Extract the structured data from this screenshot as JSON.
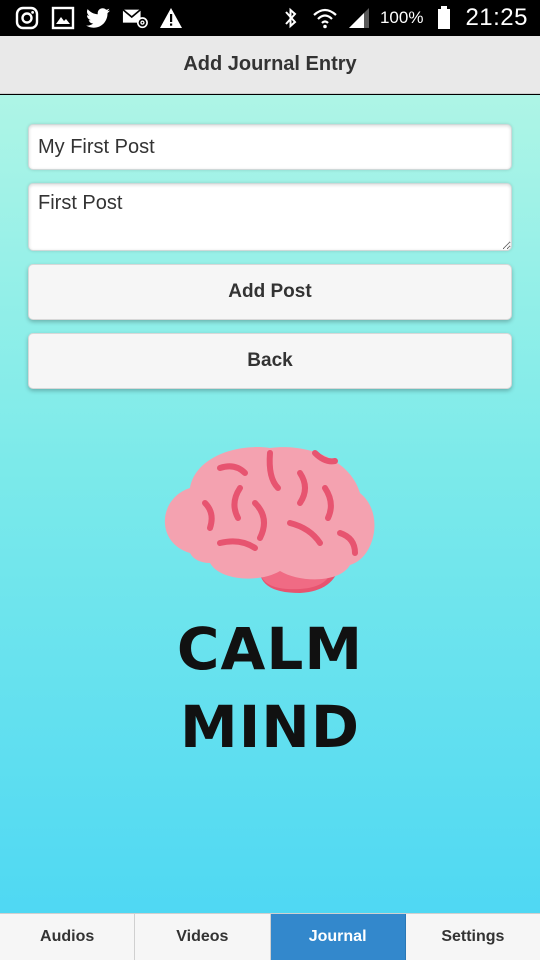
{
  "status_bar": {
    "battery": "100%",
    "time": "21:25",
    "icons": [
      "instagram-icon",
      "image-icon",
      "twitter-icon",
      "email-icon",
      "warning-icon",
      "bluetooth-icon",
      "wifi-icon",
      "signal-icon",
      "battery-icon"
    ]
  },
  "header": {
    "title": "Add Journal Entry"
  },
  "form": {
    "title_value": "My First Post",
    "body_value": "First Post",
    "add_label": "Add Post",
    "back_label": "Back"
  },
  "brand": {
    "line1": "CALM",
    "line2": "MIND",
    "logo_icon": "brain-icon"
  },
  "tabs": [
    {
      "label": "Audios",
      "active": false
    },
    {
      "label": "Videos",
      "active": false
    },
    {
      "label": "Journal",
      "active": true
    },
    {
      "label": "Settings",
      "active": false
    }
  ],
  "colors": {
    "gradient_top": "#aef5e6",
    "gradient_bottom": "#4fd8f3",
    "active_tab": "#3388cc",
    "brain": "#f4a2b0",
    "brain_lines": "#e75470"
  }
}
